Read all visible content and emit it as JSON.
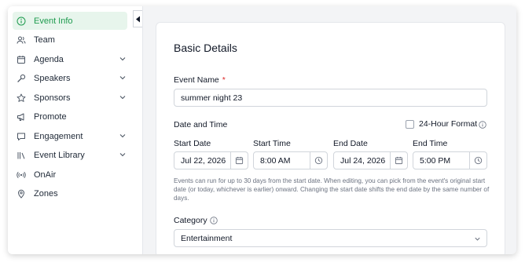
{
  "sidebar": {
    "items": [
      {
        "label": "Event Info",
        "icon": "info-circle-icon",
        "active": true,
        "has_chevron": false
      },
      {
        "label": "Team",
        "icon": "people-icon",
        "active": false,
        "has_chevron": false
      },
      {
        "label": "Agenda",
        "icon": "calendar-icon",
        "active": false,
        "has_chevron": true
      },
      {
        "label": "Speakers",
        "icon": "microphone-icon",
        "active": false,
        "has_chevron": true
      },
      {
        "label": "Sponsors",
        "icon": "star-icon",
        "active": false,
        "has_chevron": true
      },
      {
        "label": "Promote",
        "icon": "megaphone-icon",
        "active": false,
        "has_chevron": false
      },
      {
        "label": "Engagement",
        "icon": "chat-bubble-icon",
        "active": false,
        "has_chevron": true
      },
      {
        "label": "Event Library",
        "icon": "library-icon",
        "active": false,
        "has_chevron": true
      },
      {
        "label": "OnAir",
        "icon": "broadcast-icon",
        "active": false,
        "has_chevron": false
      },
      {
        "label": "Zones",
        "icon": "location-pin-icon",
        "active": false,
        "has_chevron": false
      }
    ],
    "active_color": "#1e9b4e",
    "active_bg": "#e7f5ec"
  },
  "form": {
    "section_title": "Basic Details",
    "event_name": {
      "label": "Event Name",
      "required_mark": "*",
      "value": "summer night 23"
    },
    "date_time": {
      "heading": "Date and Time",
      "format_toggle_label": "24-Hour Format",
      "format_24h_checked": false,
      "start_date": {
        "label": "Start Date",
        "value": "Jul 22, 2026"
      },
      "start_time": {
        "label": "Start Time",
        "value": "8:00 AM"
      },
      "end_date": {
        "label": "End Date",
        "value": "Jul 24, 2026"
      },
      "end_time": {
        "label": "End Time",
        "value": "5:00 PM"
      },
      "help_text": "Events can run for up to 30 days from the start date. When editing, you can pick from the event's original start date (or today, whichever is earlier) onward. Changing the start date shifts the end date by the same number of days."
    },
    "category": {
      "label": "Category",
      "value": "Entertainment"
    }
  }
}
